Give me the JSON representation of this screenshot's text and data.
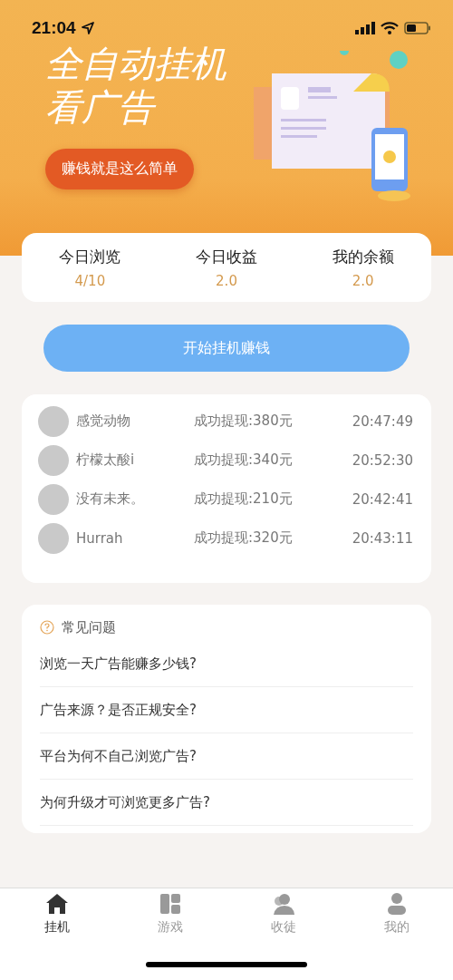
{
  "status_bar": {
    "time": "21:04"
  },
  "banner": {
    "title_lines": [
      "全自动挂机",
      "看广告"
    ],
    "button": "赚钱就是这么简单"
  },
  "stats": [
    {
      "label": "今日浏览",
      "value": "4/10"
    },
    {
      "label": "今日收益",
      "value": "2.0"
    },
    {
      "label": "我的余额",
      "value": "2.0"
    }
  ],
  "start_button": "开始挂机赚钱",
  "withdrawals": [
    {
      "name": "感觉动物",
      "text": "成功提现:380元",
      "time": "20:47:49"
    },
    {
      "name": "柠檬太酸i",
      "text": "成功提现:340元",
      "time": "20:52:30"
    },
    {
      "name": "没有未来。",
      "text": "成功提现:210元",
      "time": "20:42:41"
    },
    {
      "name": "Hurrah",
      "text": "成功提现:320元",
      "time": "20:43:11"
    }
  ],
  "faq": {
    "title": "常见问题",
    "questions": [
      "浏览一天广告能赚多少钱?",
      "广告来源？是否正规安全?",
      "平台为何不自己浏览广告?",
      "为何升级才可浏览更多广告?"
    ]
  },
  "tab_bar": [
    {
      "label": "挂机",
      "selected": true
    },
    {
      "label": "游戏",
      "selected": false
    },
    {
      "label": "收徒",
      "selected": false
    },
    {
      "label": "我的",
      "selected": false
    }
  ]
}
